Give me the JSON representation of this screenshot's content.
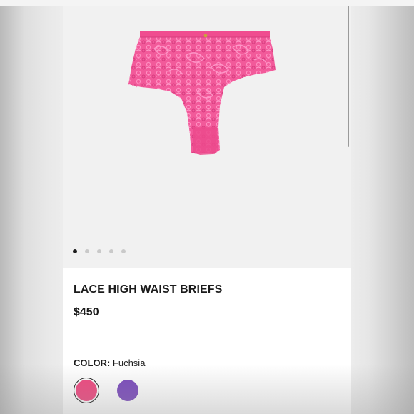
{
  "product": {
    "title": "LACE HIGH WAIST BRIEFS",
    "price": "$450",
    "color_label": "COLOR:",
    "color_value": "Fuchsia",
    "image_icon": "lace-briefs-product-image"
  },
  "gallery": {
    "total_images": 5,
    "active_index": 0
  },
  "swatches": [
    {
      "name": "Fuchsia",
      "color": "#f0467f",
      "selected": true
    },
    {
      "name": "Purple",
      "color": "#7a49bd",
      "selected": false
    }
  ],
  "colors": {
    "product_pink": "#f25a9a",
    "text": "#1b1b1b",
    "gallery_bg": "#f1f1f1"
  }
}
